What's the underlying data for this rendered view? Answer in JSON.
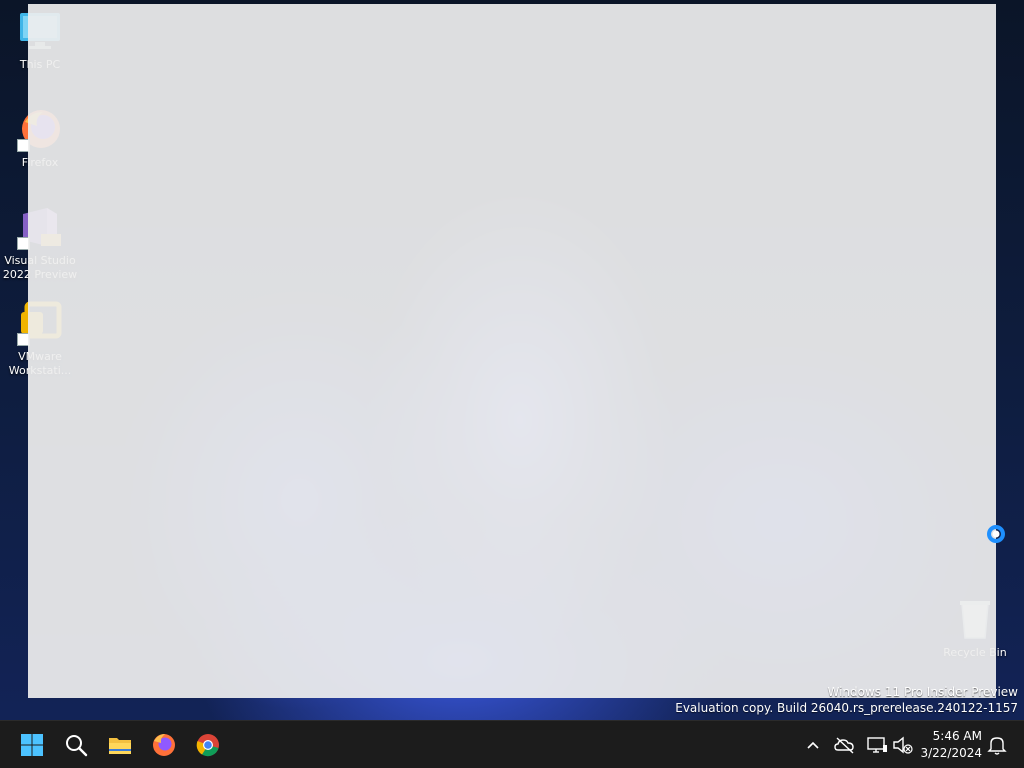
{
  "desktop": {
    "icons": [
      {
        "label": "This PC",
        "icon": "monitor-icon"
      },
      {
        "label": "Firefox",
        "icon": "firefox-icon"
      },
      {
        "label": "Visual Studio 2022 Preview",
        "icon": "visual-studio-icon",
        "badge": "PRE"
      },
      {
        "label": "VMware Workstati...",
        "icon": "vmware-icon"
      },
      {
        "label": "Recycle Bin",
        "icon": "recycle-bin-icon"
      }
    ],
    "watermark": {
      "line1": "Windows 11 Pro Insider Preview",
      "line2": "Evaluation copy. Build 26040.rs_prerelease.240122-1157"
    }
  },
  "taskbar": {
    "pinned": [
      {
        "name": "Start",
        "icon": "windows-start-icon"
      },
      {
        "name": "Search",
        "icon": "search-icon"
      },
      {
        "name": "File Explorer",
        "icon": "folder-icon"
      },
      {
        "name": "Firefox",
        "icon": "firefox-icon"
      },
      {
        "name": "Chrome",
        "icon": "chrome-icon"
      }
    ],
    "tray": {
      "icons": [
        "chevron-up-icon",
        "onedrive-offline-icon",
        "network-icon",
        "volume-muted-icon",
        "notification-bell-icon"
      ]
    },
    "clock": {
      "time": "5:46 AM",
      "date": "3/22/2024"
    }
  },
  "colors": {
    "taskbar_bg": "#1c1c1c",
    "overlay": "#eeeeee",
    "wallpaper_accent": "#3a5ae6",
    "busy_cursor": "#1e90ff"
  }
}
